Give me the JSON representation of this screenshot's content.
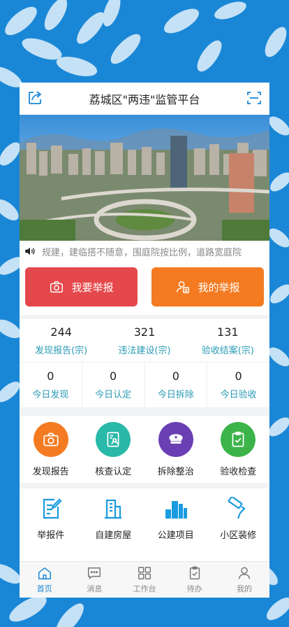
{
  "header": {
    "title": "荔城区\"两违\"监管平台"
  },
  "notice": {
    "text": "规建，建临搭不随意，围庭院按比例，道路宽庭院"
  },
  "actions": [
    {
      "label": "我要举报",
      "color": "#e5484b"
    },
    {
      "label": "我的举报",
      "color": "#f47b22"
    }
  ],
  "stats_top": [
    {
      "num": "244",
      "label": "发现报告(宗)"
    },
    {
      "num": "321",
      "label": "违法建设(宗)"
    },
    {
      "num": "131",
      "label": "验收结案(宗)"
    }
  ],
  "stats_bottom": [
    {
      "num": "0",
      "label": "今日发现"
    },
    {
      "num": "0",
      "label": "今日认定"
    },
    {
      "num": "0",
      "label": "今日拆除"
    },
    {
      "num": "0",
      "label": "今日验收"
    }
  ],
  "grid_main": [
    {
      "label": "发现报告",
      "icon": "camera-icon",
      "color": "#f47b22"
    },
    {
      "label": "核查认定",
      "icon": "id-card-icon",
      "color": "#2ab8a8"
    },
    {
      "label": "拆除整治",
      "icon": "officer-cap-icon",
      "color": "#6a3fb3"
    },
    {
      "label": "验收检查",
      "icon": "clipboard-check-icon",
      "color": "#3cb44a"
    }
  ],
  "grid_secondary": [
    {
      "label": "举报件",
      "icon": "edit-document-icon"
    },
    {
      "label": "自建房屋",
      "icon": "building-icon"
    },
    {
      "label": "公建项目",
      "icon": "city-buildings-icon"
    },
    {
      "label": "小区装修",
      "icon": "paint-roller-icon"
    }
  ],
  "tabs": [
    {
      "label": "首页",
      "icon": "home-icon",
      "active": true
    },
    {
      "label": "消息",
      "icon": "message-icon",
      "active": false
    },
    {
      "label": "工作台",
      "icon": "workbench-icon",
      "active": false
    },
    {
      "label": "待办",
      "icon": "todo-icon",
      "active": false
    },
    {
      "label": "我的",
      "icon": "profile-icon",
      "active": false
    }
  ],
  "colors": {
    "brand": "#1a87d6",
    "teal_text": "#2a9bb5"
  }
}
